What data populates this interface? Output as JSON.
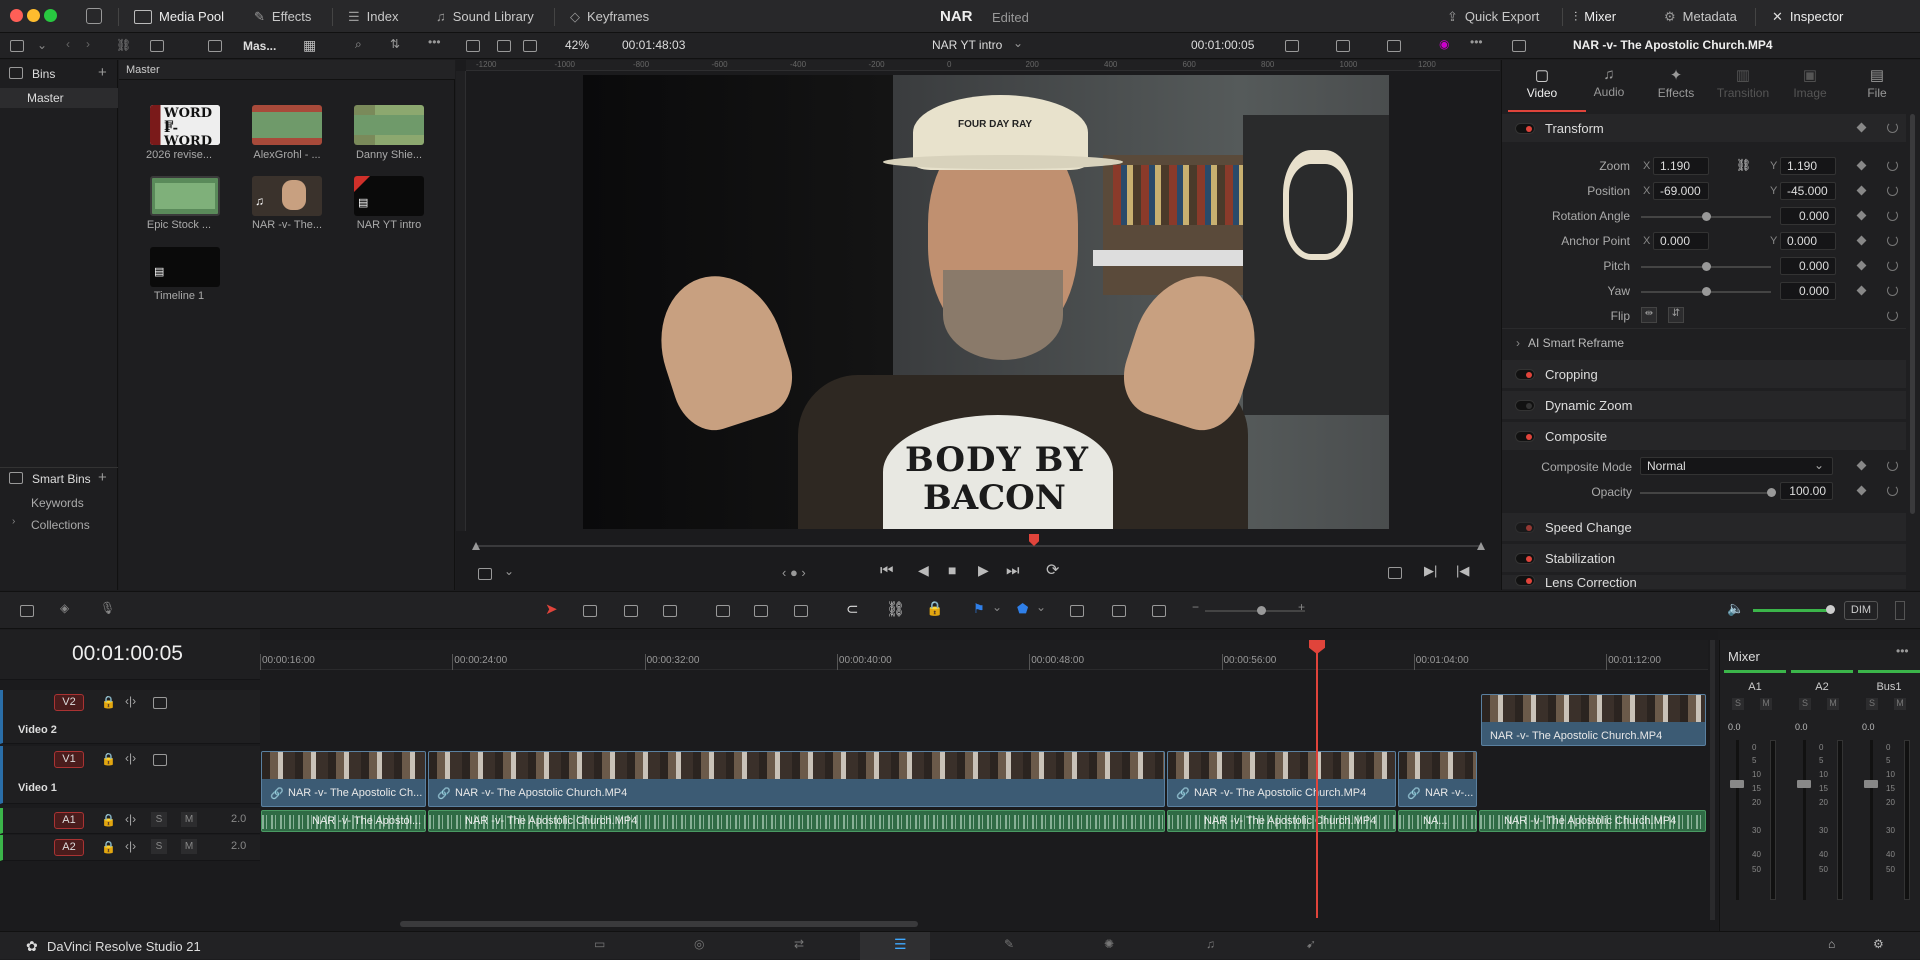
{
  "window": {
    "project": "NAR",
    "status": "Edited"
  },
  "topbar": {
    "media_pool": "Media Pool",
    "effects": "Effects",
    "index": "Index",
    "sound_library": "Sound Library",
    "keyframes": "Keyframes",
    "quick_export": "Quick Export",
    "mixer": "Mixer",
    "metadata": "Metadata",
    "inspector": "Inspector"
  },
  "bar2": {
    "bin_label": "Mas...",
    "zoom": "42%",
    "source_tc": "00:01:48:03",
    "timeline_name": "NAR YT intro",
    "record_tc": "00:01:00:05",
    "inspector_clip": "NAR -v- The Apostolic Church.MP4"
  },
  "bins": {
    "title": "Bins",
    "master": "Master",
    "smart_bins": "Smart Bins",
    "keywords": "Keywords",
    "collections": "Collections"
  },
  "pool": {
    "header": "Master",
    "items": [
      "2026 revise...",
      "AlexGrohl - ...",
      "Danny Shie...",
      "Epic Stock ...",
      "NAR -v- The...",
      "NAR YT intro",
      "Timeline 1"
    ],
    "thumb_word_line1": "WORD F",
    "thumb_word_line2": "F-WORD"
  },
  "viewer": {
    "ruler_ticks": [
      "-1200",
      "-1000",
      "-800",
      "-600",
      "-400",
      "-200",
      "0",
      "200",
      "400",
      "600",
      "800",
      "1000",
      "1200"
    ],
    "video_text": {
      "cap": "FOUR DAY RAY",
      "shirt_1": "BODY BY",
      "shirt_2": "BACON"
    }
  },
  "inspector": {
    "tabs": [
      "Video",
      "Audio",
      "Effects",
      "Transition",
      "Image",
      "File"
    ],
    "transform": "Transform",
    "zoom_label": "Zoom",
    "zoom_x": "1.190",
    "zoom_y": "1.190",
    "position_label": "Position",
    "pos_x": "-69.000",
    "pos_y": "-45.000",
    "rotation_label": "Rotation Angle",
    "rotation": "0.000",
    "anchor_label": "Anchor Point",
    "anchor_x": "0.000",
    "anchor_y": "0.000",
    "pitch_label": "Pitch",
    "pitch": "0.000",
    "yaw_label": "Yaw",
    "yaw": "0.000",
    "flip_label": "Flip",
    "x": "X",
    "y": "Y",
    "ai_reframe": "AI Smart Reframe",
    "cropping": "Cropping",
    "dynamic_zoom": "Dynamic Zoom",
    "composite": "Composite",
    "composite_mode_label": "Composite Mode",
    "composite_mode": "Normal",
    "opacity_label": "Opacity",
    "opacity": "100.00",
    "speed_change": "Speed Change",
    "stabilization": "Stabilization",
    "lens_correction": "Lens Correction"
  },
  "timeline": {
    "timecode": "00:01:00:05",
    "ruler": [
      "00:00:16:00",
      "00:00:24:00",
      "00:00:32:00",
      "00:00:40:00",
      "00:00:48:00",
      "00:00:56:00",
      "00:01:04:00",
      "00:01:12:00"
    ],
    "v2": "V2",
    "v2_name": "Video 2",
    "v1": "V1",
    "v1_name": "Video 1",
    "a1": "A1",
    "a2": "A2",
    "a1_level": "2.0",
    "a2_level": "2.0",
    "s": "S",
    "m": "M",
    "clips": {
      "v1_1": "NAR -v- The Apostolic Ch...",
      "v1_2": "NAR -v- The Apostolic Church.MP4",
      "v1_3": "NAR -v- The Apostolic Church.MP4",
      "v1_4": "NAR -v-...",
      "v2_1": "NAR -v- The Apostolic Church.MP4",
      "a1_1": "NAR -v- The Apostol...",
      "a1_2": "NAR -v- The Apostolic Church.MP4",
      "a1_3": "NAR -v- The Apostolic Church.MP4",
      "a1_4": "NA...",
      "a1_5": "NAR -v- The Apostolic Church.MP4"
    },
    "dim": "DIM"
  },
  "mixer": {
    "title": "Mixer",
    "channels": [
      "A1",
      "A2",
      "Bus1"
    ],
    "level": "0.0",
    "scale": [
      "0",
      "5",
      "10",
      "15",
      "20",
      "30",
      "40",
      "50"
    ]
  },
  "footer": {
    "app_name": "DaVinci Resolve Studio 21"
  },
  "colors": {
    "accent_red": "#e0443b",
    "video_clip": "#3c5b74",
    "audio_clip": "#2f6b45",
    "playhead": "#e0443b"
  }
}
